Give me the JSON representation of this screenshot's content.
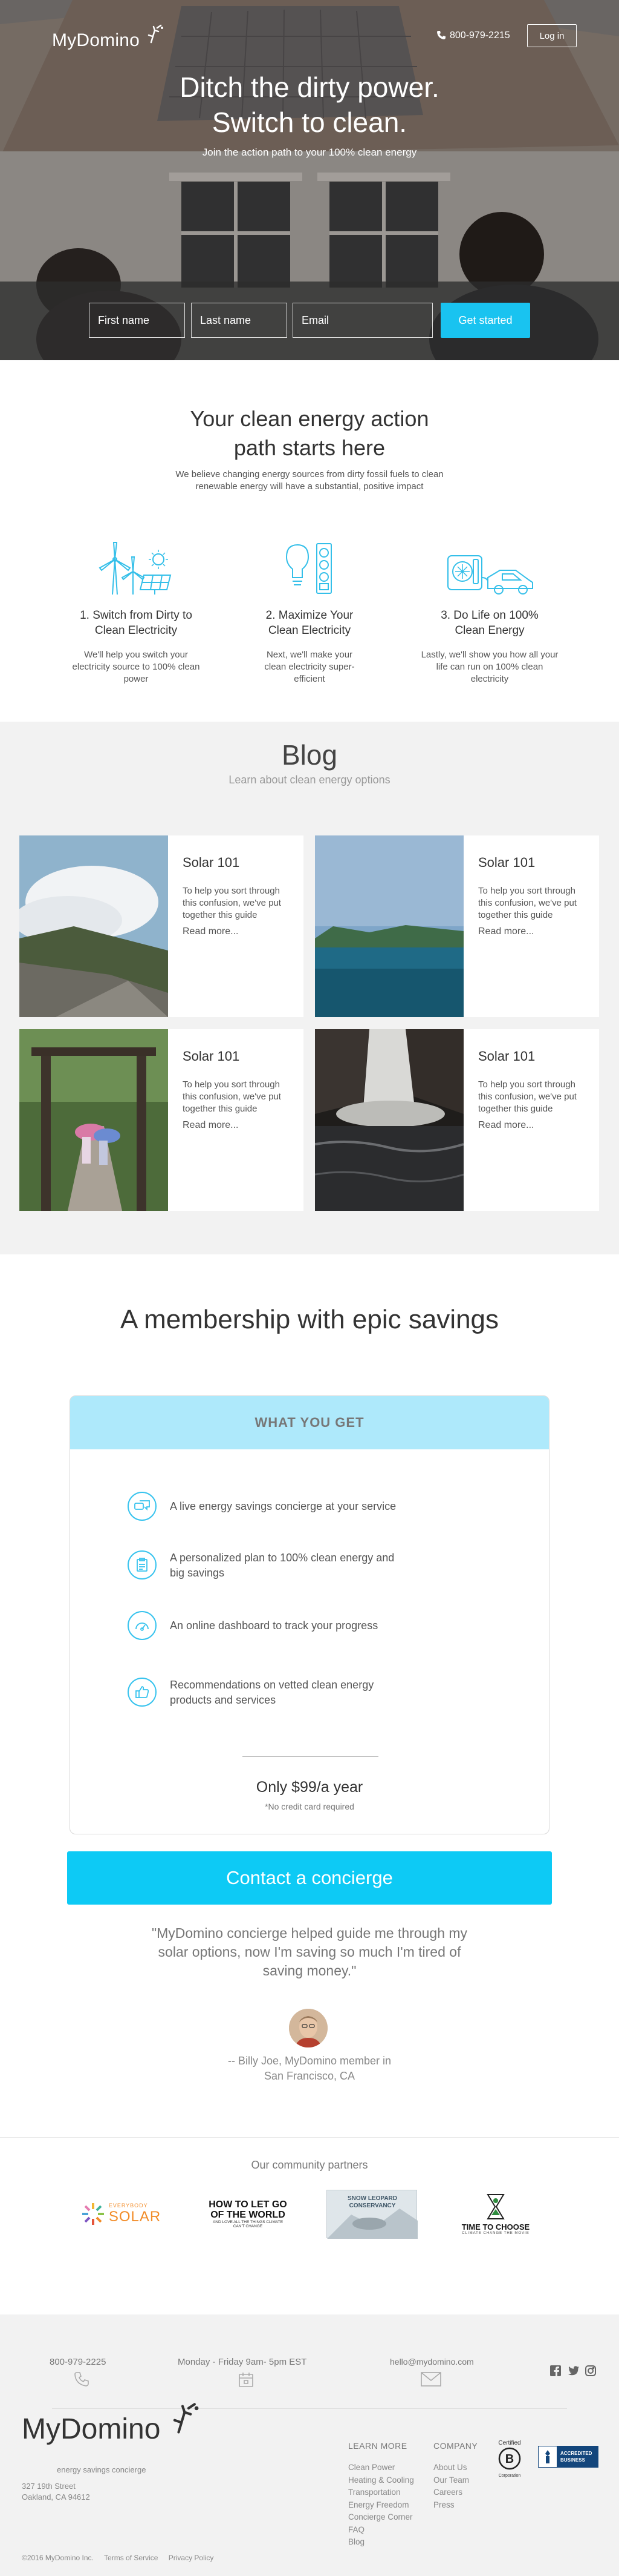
{
  "header": {
    "logo": "MyDomino",
    "phone": "800-979-2215",
    "login_label": "Log in"
  },
  "hero": {
    "title_line1": "Ditch the dirty power.",
    "title_line2": "Switch to clean.",
    "subtitle": "Join the action path to your 100% clean energy",
    "first_name_placeholder": "First name",
    "last_name_placeholder": "Last name",
    "email_placeholder": "Email",
    "cta_label": "Get started"
  },
  "path": {
    "title_line1": "Your clean energy action",
    "title_line2": "path starts here",
    "description": "We believe changing energy sources from dirty fossil fuels to clean renewable energy will have a substantial, positive impact",
    "steps": [
      {
        "title_line1": "1. Switch from Dirty to",
        "title_line2": "Clean Electricity",
        "desc": "We'll help you switch your electricity source to 100% clean power",
        "icon": "wind-solar-icon"
      },
      {
        "title_line1": "2. Maximize Your",
        "title_line2": "Clean Electricity",
        "desc": "Next, we'll make your clean electricity super-efficient",
        "icon": "bulb-battery-icon"
      },
      {
        "title_line1": "3. Do Life on 100%",
        "title_line2": "Clean Energy",
        "desc": "Lastly, we'll show you how all your life can run on 100% clean electricity",
        "icon": "ev-charger-icon"
      }
    ]
  },
  "blog": {
    "title": "Blog",
    "subtitle": "Learn about clean energy options",
    "posts": [
      {
        "title": "Solar 101",
        "body": "To help you sort through this confusion, we've put together this guide",
        "read_more": "Read more..."
      },
      {
        "title": "Solar 101",
        "body": "To help you sort through this confusion, we've put together this guide",
        "read_more": "Read more..."
      },
      {
        "title": "Solar 101",
        "body": "To help you sort through this confusion, we've put together this guide",
        "read_more": "Read more..."
      },
      {
        "title": "Solar 101",
        "body": "To help you sort through this confusion, we've put together this guide",
        "read_more": "Read more..."
      }
    ]
  },
  "membership": {
    "title": "A membership with epic savings",
    "box_heading": "WHAT YOU GET",
    "features": [
      {
        "text": "A live energy savings concierge at your service",
        "icon": "chat-icon"
      },
      {
        "text": "A personalized plan to 100% clean energy and big savings",
        "icon": "plan-icon"
      },
      {
        "text": "An online dashboard to track your progress",
        "icon": "dashboard-icon"
      },
      {
        "text": "Recommendations on vetted clean energy products and services",
        "icon": "thumbs-up-icon"
      }
    ],
    "price": "Only $99/a year",
    "price_note": "*No credit card required",
    "cta_label": "Contact a concierge"
  },
  "testimonial": {
    "quote": "\"MyDomino concierge helped guide me through my solar options, now I'm saving so much I'm tired of saving money.\"",
    "author_line1": "-- Billy Joe, MyDomino member in",
    "author_line2": "San Francisco, CA"
  },
  "partners": {
    "title": "Our community partners",
    "logos": [
      {
        "line1": "EVERYBODY",
        "line2": "SOLAR"
      },
      {
        "line1": "HOW TO LET GO",
        "line2": "OF THE WORLD",
        "line3": "AND LOVE ALL THE THINGS CLIMATE CAN'T CHANGE"
      },
      {
        "line1": "SNOW LEOPARD",
        "line2": "CONSERVANCY"
      },
      {
        "line1": "TIME TO CHOOSE",
        "line2": "CLIMATE CHANGE THE MOVIE"
      }
    ]
  },
  "footer": {
    "phone": "800-979-2225",
    "hours": "Monday - Friday 9am- 5pm EST",
    "email": "hello@mydomino.com",
    "logo": "MyDomino",
    "tagline": "energy savings concierge",
    "address_line1": "327 19th Street",
    "address_line2": "Oakland, CA 94612",
    "learn_more_heading": "LEARN MORE",
    "learn_more_links": [
      "Clean Power",
      "Heating & Cooling",
      "Transportation",
      "Energy Freedom",
      "Concierge Corner",
      "FAQ",
      "Blog"
    ],
    "company_heading": "COMPANY",
    "company_links": [
      "About Us",
      "Our Team",
      "Careers",
      "Press"
    ],
    "bcorp_label": "Certified",
    "bcorp_sub": "Corporation",
    "bbb_line1": "ACCREDITED",
    "bbb_line2": "BUSINESS",
    "copyright": "©2016 MyDomino Inc.",
    "terms": "Terms of Service",
    "privacy": "Privacy Policy"
  },
  "colors": {
    "accent": "#19c3f0",
    "accent_light": "#aee9fb",
    "footer_bg": "#f2f2f2"
  }
}
